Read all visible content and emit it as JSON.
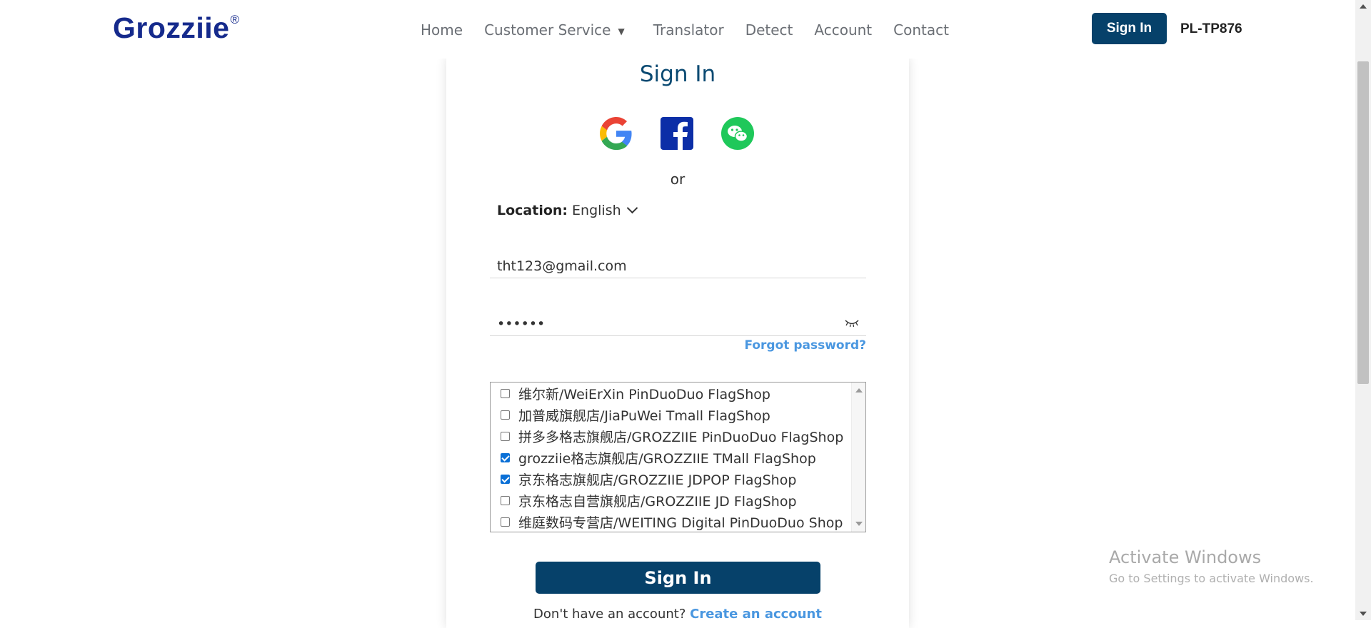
{
  "header": {
    "logo": "Grozziie",
    "logo_mark": "®",
    "nav": [
      "Home",
      "Customer Service",
      "Translator",
      "Detect",
      "Account",
      "Contact"
    ],
    "signin_label": "Sign In",
    "account_code": "PL-TP876"
  },
  "form": {
    "title": "Sign In",
    "socials": [
      "google-icon",
      "facebook-icon",
      "wechat-icon"
    ],
    "or": "or",
    "location_label": "Location:",
    "location_value": "English",
    "email_value": "tht123@gmail.com",
    "password_value": "••••••",
    "forgot": "Forgot password?",
    "shops": [
      {
        "label": "维尔新/WeiErXin PinDuoDuo FlagShop",
        "checked": false
      },
      {
        "label": "加普威旗舰店/JiaPuWei Tmall FlagShop",
        "checked": false
      },
      {
        "label": "拼多多格志旗舰店/GROZZIIE PinDuoDuo FlagShop",
        "checked": false
      },
      {
        "label": "grozziie格志旗舰店/GROZZIIE TMall FlagShop",
        "checked": true
      },
      {
        "label": "京东格志旗舰店/GROZZIIE JDPOP FlagShop",
        "checked": true
      },
      {
        "label": "京东格志自营旗舰店/GROZZIIE JD FlagShop",
        "checked": false
      },
      {
        "label": "维庭数码专营店/WEITING Digital PinDuoDuo Shop",
        "checked": false
      }
    ],
    "submit_label": "Sign In",
    "no_account": "Don't have an account?",
    "create_account": "Create an account"
  },
  "watermark": {
    "title": "Activate Windows",
    "subtitle": "Go to Settings to activate Windows."
  },
  "colors": {
    "brand": "#06416a",
    "logo": "#152a8c",
    "link": "#4a97e0"
  }
}
